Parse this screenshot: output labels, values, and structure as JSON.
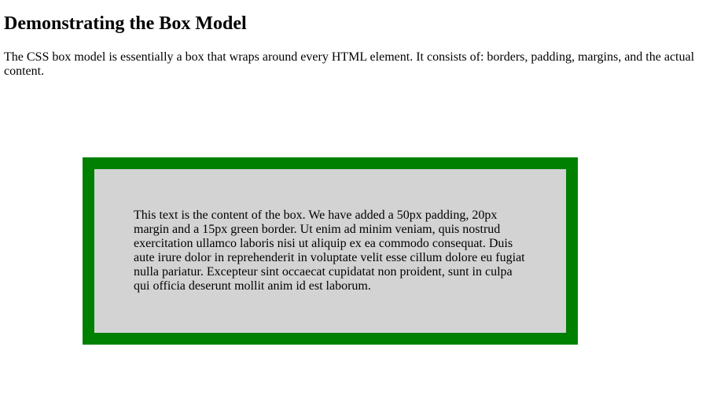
{
  "header": {
    "title": "Demonstrating the Box Model"
  },
  "intro": {
    "text": "The CSS box model is essentially a box that wraps around every HTML element. It consists of: borders, padding, margins, and the actual content."
  },
  "demo_box": {
    "content": "This text is the content of the box. We have added a 50px padding, 20px margin and a 15px green border. Ut enim ad minim veniam, quis nostrud exercitation ullamco laboris nisi ut aliquip ex ea commodo consequat. Duis aute irure dolor in reprehenderit in voluptate velit esse cillum dolore eu fugiat nulla pariatur. Excepteur sint occaecat cupidatat non proident, sunt in culpa qui officia deserunt mollit anim id est laborum.",
    "border_color": "#008000",
    "background_color": "#d3d3d3"
  },
  "page": {
    "background_color": "#ffffff",
    "text_color": "#000000"
  }
}
